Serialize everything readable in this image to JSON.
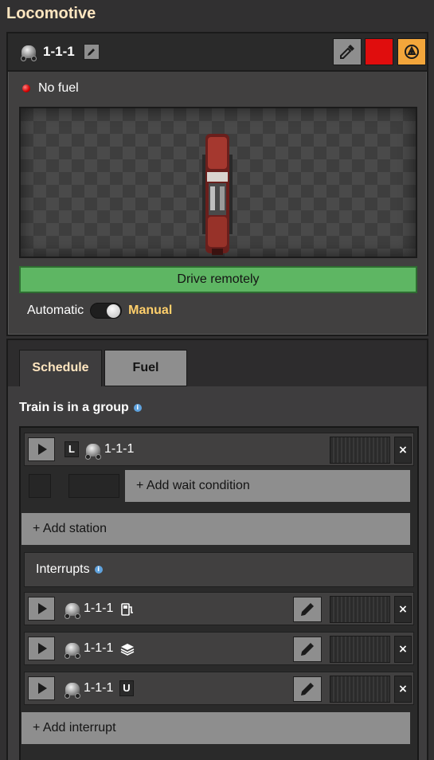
{
  "window": {
    "title": "Locomotive"
  },
  "header": {
    "name": "1-1-1",
    "color_swatch": "#e00d0d"
  },
  "status": {
    "text": "No fuel",
    "indicator_color": "#d40000"
  },
  "actions": {
    "drive_remotely": "Drive remotely"
  },
  "mode": {
    "automatic_label": "Automatic",
    "manual_label": "Manual",
    "selected": "Manual"
  },
  "tabs": [
    {
      "label": "Schedule",
      "active": true
    },
    {
      "label": "Fuel",
      "active": false
    }
  ],
  "schedule": {
    "group_label": "Train is in a group",
    "station": {
      "badge": "L",
      "name": "1-1-1"
    },
    "add_wait_condition": "+ Add wait condition",
    "add_station": "+ Add station",
    "interrupts_label": "Interrupts",
    "interrupts": [
      {
        "name": "1-1-1",
        "icon": "fuel-pump-icon"
      },
      {
        "name": "1-1-1",
        "icon": "stack-icon"
      },
      {
        "name": "1-1-1",
        "badge": "U"
      }
    ],
    "add_interrupt": "+ Add interrupt"
  },
  "close_glyph": "×",
  "colors": {
    "accent_header": "#ffe6c0",
    "manual": "#ffcf6b",
    "drive_button": "#5eb663"
  }
}
